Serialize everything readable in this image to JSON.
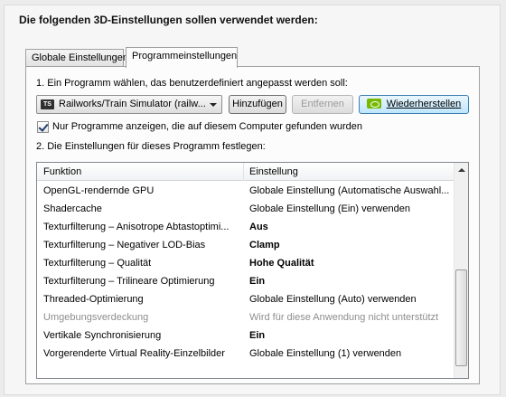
{
  "heading": "Die folgenden 3D-Einstellungen sollen verwendet werden:",
  "tabs": [
    {
      "label": "Globale Einstellungen",
      "active": false
    },
    {
      "label": "Programmeinstellungen",
      "active": true
    }
  ],
  "step1": {
    "label": "1. Ein Programm wählen, das benutzerdefiniert angepasst werden soll:",
    "program_icon": "TS",
    "program_value": "Railworks/Train Simulator (railw...",
    "add_button": "Hinzufügen",
    "remove_button": "Entfernen",
    "restore_button": "Wiederherstellen",
    "restore_icon": "nvidia-icon"
  },
  "filter": {
    "checked": true,
    "label": "Nur Programme anzeigen, die auf diesem Computer gefunden wurden"
  },
  "step2": {
    "label": "2. Die Einstellungen für dieses Programm festlegen:",
    "columns": [
      "Funktion",
      "Einstellung"
    ],
    "rows": [
      {
        "feature": "OpenGL-rendernde GPU",
        "setting": "Globale Einstellung (Automatische Auswahl...",
        "style": "normal"
      },
      {
        "feature": "Shadercache",
        "setting": "Globale Einstellung (Ein) verwenden",
        "style": "normal"
      },
      {
        "feature": "Texturfilterung – Anisotrope Abtastoptimi...",
        "setting": "Aus",
        "style": "bold"
      },
      {
        "feature": "Texturfilterung – Negativer LOD-Bias",
        "setting": "Clamp",
        "style": "bold"
      },
      {
        "feature": "Texturfilterung – Qualität",
        "setting": "Hohe Qualität",
        "style": "bold"
      },
      {
        "feature": "Texturfilterung – Trilineare Optimierung",
        "setting": "Ein",
        "style": "bold"
      },
      {
        "feature": "Threaded-Optimierung",
        "setting": "Globale Einstellung (Auto) verwenden",
        "style": "normal"
      },
      {
        "feature": "Umgebungsverdeckung",
        "setting": "Wird für diese Anwendung nicht unterstützt",
        "style": "gray"
      },
      {
        "feature": "Vertikale Synchronisierung",
        "setting": "Ein",
        "style": "bold"
      },
      {
        "feature": "Vorgerenderte Virtual Reality-Einzelbilder",
        "setting": "Globale Einstellung (1) verwenden",
        "style": "normal"
      }
    ]
  }
}
